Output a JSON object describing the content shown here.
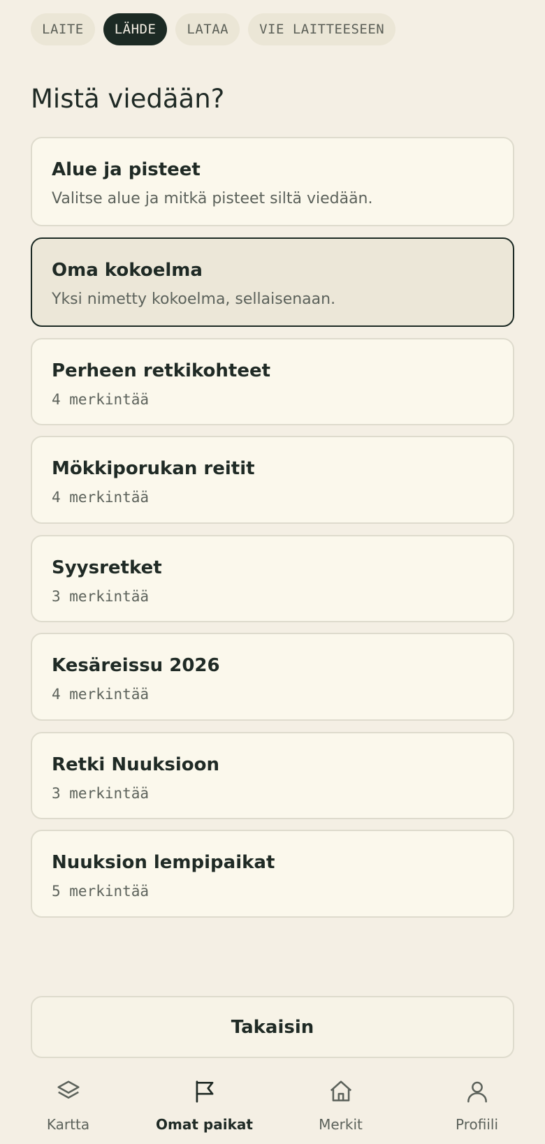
{
  "steps": [
    {
      "label": "LAITE",
      "active": false
    },
    {
      "label": "LÄHDE",
      "active": true
    },
    {
      "label": "LATAA",
      "active": false
    },
    {
      "label": "VIE LAITTEESEEN",
      "active": false
    }
  ],
  "heading": "Mistä viedään?",
  "options": [
    {
      "title": "Alue ja pisteet",
      "subtitle": "Valitse alue ja mitkä pisteet siltä viedään."
    },
    {
      "title": "Oma kokoelma",
      "subtitle": "Yksi nimetty kokoelma, sellaisenaan.",
      "selected": true
    }
  ],
  "collections": [
    {
      "title": "Perheen retkikohteet",
      "count": "4 merkintää"
    },
    {
      "title": "Mökkiporukan reitit",
      "count": "4 merkintää"
    },
    {
      "title": "Syysretket",
      "count": "3 merkintää"
    },
    {
      "title": "Kesäreissu 2026",
      "count": "4 merkintää"
    },
    {
      "title": "Retki Nuuksioon",
      "count": "3 merkintää"
    },
    {
      "title": "Nuuksion lempipaikat",
      "count": "5 merkintää"
    }
  ],
  "back_label": "Takaisin",
  "nav": [
    {
      "label": "Kartta",
      "icon": "layers-icon",
      "active": false
    },
    {
      "label": "Omat paikat",
      "icon": "flag-icon",
      "active": true
    },
    {
      "label": "Merkit",
      "icon": "home-icon",
      "active": false
    },
    {
      "label": "Profiili",
      "icon": "user-icon",
      "active": false
    }
  ],
  "colors": {
    "background": "#f4efe4",
    "accent_dark": "#1c2a24",
    "card": "#fbf8ec",
    "card_selected": "#ece7d8"
  }
}
